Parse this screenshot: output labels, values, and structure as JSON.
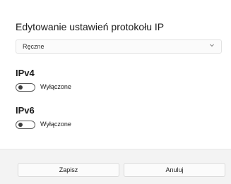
{
  "dialog": {
    "title": "Edytowanie ustawień protokołu IP",
    "mode_dropdown": {
      "value": "Ręczne",
      "icon": "chevron-down-icon"
    },
    "ipv4": {
      "heading": "IPv4",
      "toggle_label": "Wyłączone",
      "enabled": false
    },
    "ipv6": {
      "heading": "IPv6",
      "toggle_label": "Wyłączone",
      "enabled": false
    },
    "buttons": {
      "save": "Zapisz",
      "cancel": "Anuluj"
    }
  }
}
